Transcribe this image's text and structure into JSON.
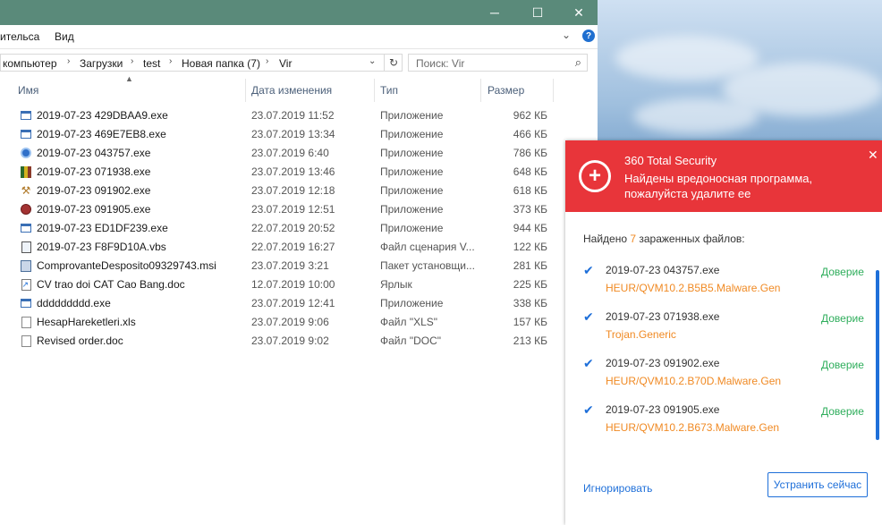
{
  "explorer": {
    "ribbon": {
      "tab_share": "ительса",
      "tab_view": "Вид",
      "help": "?"
    },
    "address": {
      "crumbs": [
        "компьютер",
        "Загрузки",
        "test",
        "Новая папка (7)",
        "Vir"
      ],
      "refresh_icon": "refresh-icon"
    },
    "search": {
      "placeholder": "Поиск: Vir"
    },
    "columns": {
      "name": "Имя",
      "date": "Дата изменения",
      "type": "Тип",
      "size": "Размер"
    },
    "files": [
      {
        "name": "2019-07-23 429DBAA9.exe",
        "date": "23.07.2019 11:52",
        "type": "Приложение",
        "size": "962 КБ",
        "icon": "exe-window-icon"
      },
      {
        "name": "2019-07-23 469E7EB8.exe",
        "date": "23.07.2019 13:34",
        "type": "Приложение",
        "size": "466 КБ",
        "icon": "exe-window-icon"
      },
      {
        "name": "2019-07-23 043757.exe",
        "date": "23.07.2019 6:40",
        "type": "Приложение",
        "size": "786 КБ",
        "icon": "gear-app-icon"
      },
      {
        "name": "2019-07-23 071938.exe",
        "date": "23.07.2019 13:46",
        "type": "Приложение",
        "size": "648 КБ",
        "icon": "archive-app-icon"
      },
      {
        "name": "2019-07-23 091902.exe",
        "date": "23.07.2019 12:18",
        "type": "Приложение",
        "size": "618 КБ",
        "icon": "wrench-app-icon"
      },
      {
        "name": "2019-07-23 091905.exe",
        "date": "23.07.2019 12:51",
        "type": "Приложение",
        "size": "373 КБ",
        "icon": "red-emblem-icon"
      },
      {
        "name": "2019-07-23 ED1DF239.exe",
        "date": "22.07.2019 20:52",
        "type": "Приложение",
        "size": "944 КБ",
        "icon": "exe-window-icon"
      },
      {
        "name": "2019-07-23 F8F9D10A.vbs",
        "date": "22.07.2019 16:27",
        "type": "Файл сценария V...",
        "size": "122 КБ",
        "icon": "script-file-icon"
      },
      {
        "name": "ComprovanteDesposito09329743.msi",
        "date": "23.07.2019 3:21",
        "type": "Пакет установщи...",
        "size": "281 КБ",
        "icon": "installer-icon"
      },
      {
        "name": "CV trao doi CAT Cao Bang.doc",
        "date": "12.07.2019 10:00",
        "type": "Ярлык",
        "size": "225 КБ",
        "icon": "shortcut-icon"
      },
      {
        "name": "ddddddddd.exe",
        "date": "23.07.2019 12:41",
        "type": "Приложение",
        "size": "338 КБ",
        "icon": "exe-window-icon"
      },
      {
        "name": "HesapHareketleri.xls",
        "date": "23.07.2019 9:06",
        "type": "Файл \"XLS\"",
        "size": "157 КБ",
        "icon": "blank-file-icon"
      },
      {
        "name": "Revised order.doc",
        "date": "23.07.2019 9:02",
        "type": "Файл \"DOC\"",
        "size": "213 КБ",
        "icon": "blank-file-icon"
      }
    ]
  },
  "popup": {
    "app_name": "360 Total Security",
    "message": "Найдены вредоносная программа, пожалуйста удалите ее",
    "count_prefix": "Найдено ",
    "count": "7",
    "count_suffix": " зараженных файлов:",
    "threats": [
      {
        "file": "2019-07-23 043757.exe",
        "detection": "HEUR/QVM10.2.B5B5.Malware.Gen",
        "action": "Доверие"
      },
      {
        "file": "2019-07-23 071938.exe",
        "detection": "Trojan.Generic",
        "action": "Доверие"
      },
      {
        "file": "2019-07-23 091902.exe",
        "detection": "HEUR/QVM10.2.B70D.Malware.Gen",
        "action": "Доверие"
      },
      {
        "file": "2019-07-23 091905.exe",
        "detection": "HEUR/QVM10.2.B673.Malware.Gen",
        "action": "Доверие"
      }
    ],
    "ignore_label": "Игнорировать",
    "fix_label": "Устранить сейчас",
    "colors": {
      "header": "#e8353a",
      "accent": "#1e6fd9",
      "virus": "#f08a24",
      "trust": "#2fae5c"
    }
  }
}
